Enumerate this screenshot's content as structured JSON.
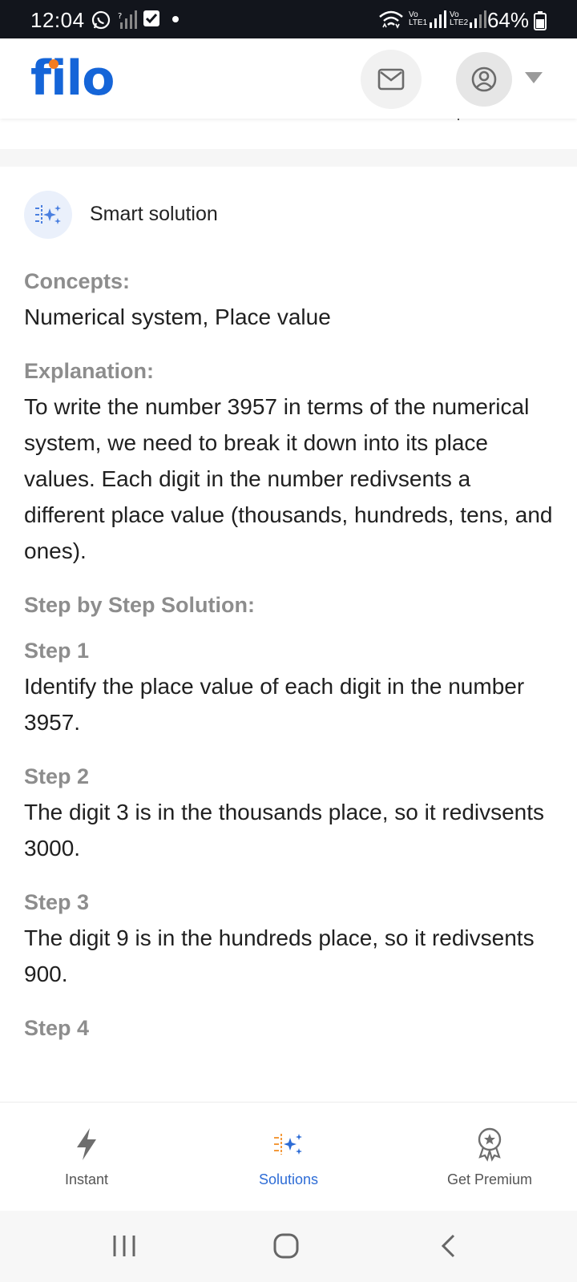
{
  "status_bar": {
    "time": "12:04",
    "battery": "64%",
    "sim1": "LTE1",
    "sim2": "LTE2",
    "icons": [
      "whatsapp-icon",
      "signal-off-icon",
      "check-notification-icon",
      "dot-icon",
      "wifi-icon",
      "signal-icon",
      "battery-icon"
    ]
  },
  "header": {
    "logo": "filo",
    "brand_color": "#1565d8",
    "accent_color": "#f57c1f",
    "icons": [
      "mail-icon",
      "account-icon",
      "caret-down-icon"
    ]
  },
  "solution": {
    "title": "Smart solution",
    "concepts_label": "Concepts:",
    "concepts": "Numerical system, Place value",
    "explanation_label": "Explanation:",
    "explanation": "To write the number 3957 in terms of the numerical system, we need to break it down into its place values. Each digit in the number redivsents a different place value (thousands, hundreds, tens, and ones).",
    "steps_label": "Step by Step Solution:",
    "steps": [
      {
        "label": "Step 1",
        "text": "Identify the place value of each digit in the number 3957."
      },
      {
        "label": "Step 2",
        "text": "The digit 3 is in the thousands place, so it redivsents 3000."
      },
      {
        "label": "Step 3",
        "text": "The digit 9 is in the hundreds place, so it redivsents 900."
      },
      {
        "label": "Step 4",
        "text": ""
      }
    ]
  },
  "bottom_nav": {
    "items": [
      {
        "label": "Instant",
        "icon": "bolt-icon",
        "active": false
      },
      {
        "label": "Solutions",
        "icon": "sparkle-icon",
        "active": true
      },
      {
        "label": "Get Premium",
        "icon": "award-icon",
        "active": false
      }
    ],
    "active_color": "#2d6cd6"
  },
  "system_nav": {
    "icons": [
      "recent-apps-icon",
      "home-icon",
      "back-icon"
    ]
  }
}
